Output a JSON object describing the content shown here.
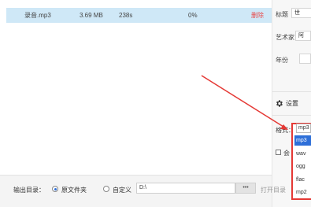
{
  "file_row": {
    "name": "录音.mp3",
    "size": "3.69 MB",
    "duration": "238s",
    "progress": "0%",
    "delete_label": "删除"
  },
  "right_panel": {
    "title_label": "标题",
    "title_value": "世",
    "artist_label": "艺术家",
    "artist_value": "阿",
    "year_label": "年份",
    "settings_label": "设置",
    "format_label": "格式：",
    "checkbox_label": "会",
    "format_selected": "mp3",
    "format_options": [
      "mp3",
      "wav",
      "ogg",
      "flac",
      "mp2"
    ]
  },
  "bottom": {
    "output_label": "输出目录：",
    "radio_source": "原文件夹",
    "radio_custom": "自定义",
    "path_value": "D:\\",
    "browse_label": "•••",
    "open_dir": "打开目录"
  },
  "colors": {
    "row_highlight": "#cfe8f7",
    "annotation_red": "#e53935",
    "selected_blue": "#2e6fd8"
  }
}
